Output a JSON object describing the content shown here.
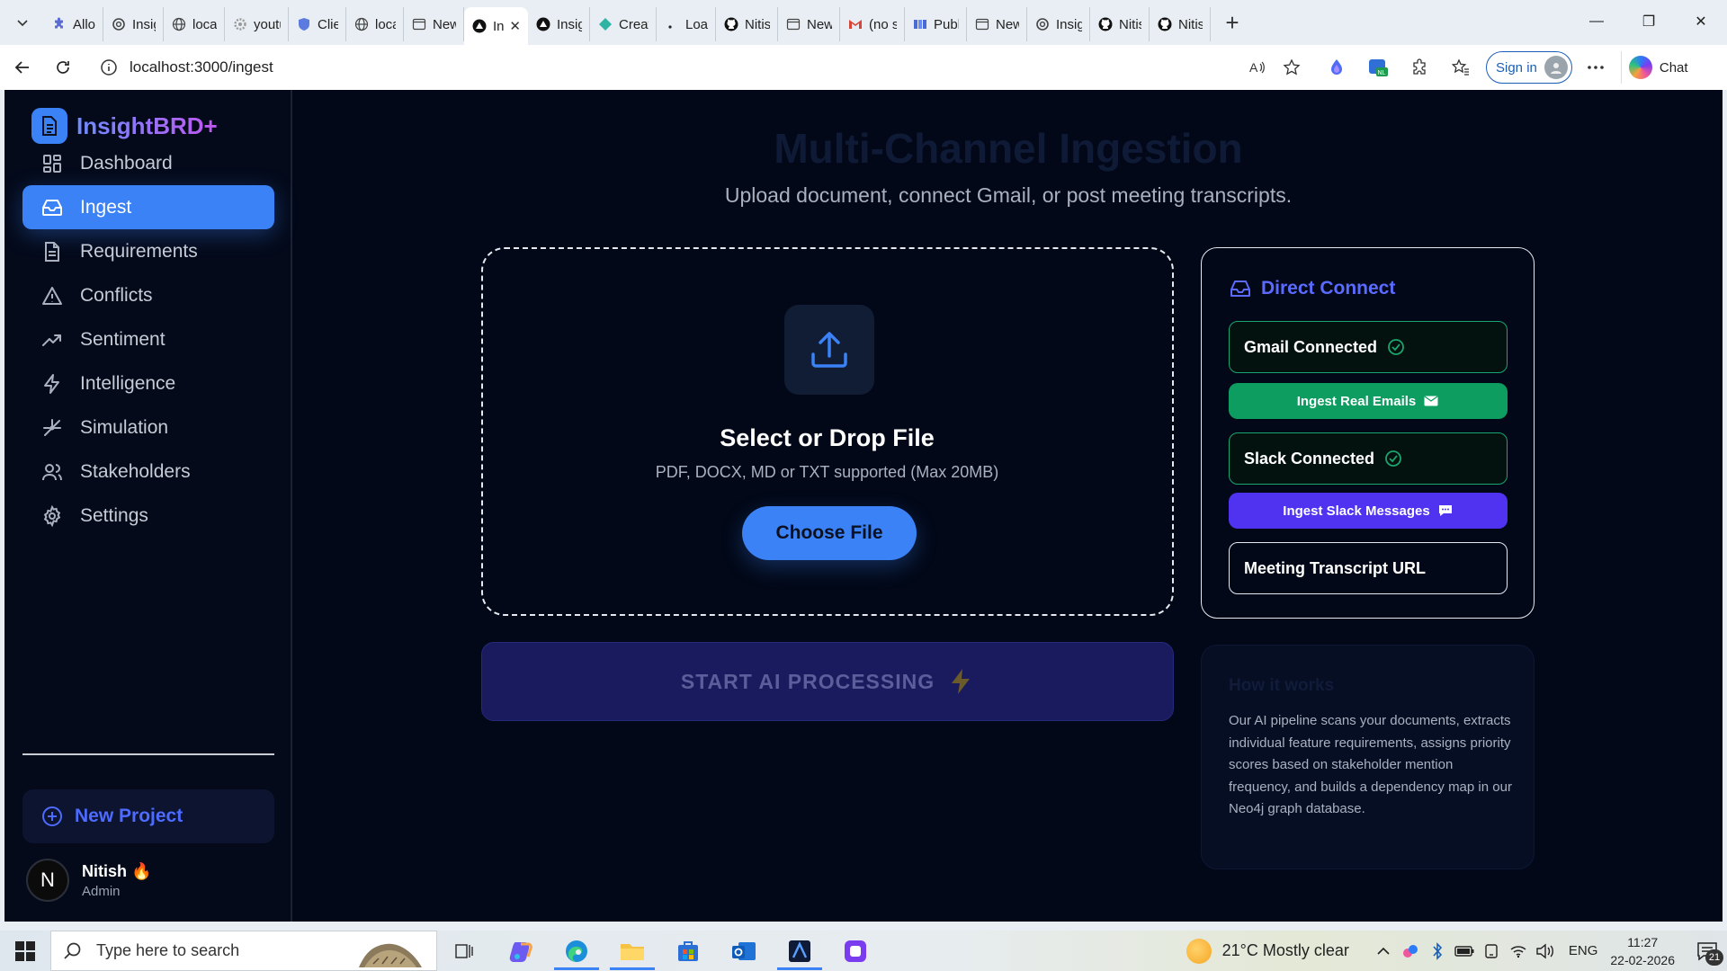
{
  "browser": {
    "tabs": [
      {
        "title": "Allow",
        "icon": "puzzle-icon"
      },
      {
        "title": "Insight",
        "icon": "openai-icon"
      },
      {
        "title": "localhc",
        "icon": "globe-icon"
      },
      {
        "title": "youtub",
        "icon": "settings-gear-icon"
      },
      {
        "title": "Client",
        "icon": "shield-icon"
      },
      {
        "title": "localhc",
        "icon": "globe-icon"
      },
      {
        "title": "New ta",
        "icon": "newtab-icon"
      },
      {
        "title": "In",
        "icon": "vercel-icon",
        "active": true
      },
      {
        "title": "Insight",
        "icon": "vercel-icon"
      },
      {
        "title": "Create",
        "icon": "diamond-icon"
      },
      {
        "title": "Loadir",
        "icon": "dot-icon"
      },
      {
        "title": "Nitish",
        "icon": "github-icon"
      },
      {
        "title": "New ta",
        "icon": "newtab-icon"
      },
      {
        "title": "(no su",
        "icon": "gmail-icon"
      },
      {
        "title": "Publis",
        "icon": "grid-icon"
      },
      {
        "title": "New ta",
        "icon": "newtab-icon"
      },
      {
        "title": "Insight",
        "icon": "openai-icon"
      },
      {
        "title": "Nitish",
        "icon": "github-icon"
      },
      {
        "title": "Nitish",
        "icon": "github-icon"
      }
    ],
    "url": "localhost:3000/ingest",
    "sign_in_label": "Sign in",
    "chat_label": "Chat"
  },
  "sidebar": {
    "brand": "InsightBRD+",
    "items": [
      {
        "label": "Dashboard",
        "icon": "dashboard-grid-icon",
        "active": false
      },
      {
        "label": "Ingest",
        "icon": "inbox-icon",
        "active": true
      },
      {
        "label": "Requirements",
        "icon": "file-text-icon",
        "active": false
      },
      {
        "label": "Conflicts",
        "icon": "alert-triangle-icon",
        "active": false
      },
      {
        "label": "Sentiment",
        "icon": "trending-up-icon",
        "active": false
      },
      {
        "label": "Intelligence",
        "icon": "zap-icon",
        "active": false
      },
      {
        "label": "Simulation",
        "icon": "simulation-icon",
        "active": false
      },
      {
        "label": "Stakeholders",
        "icon": "users-icon",
        "active": false
      },
      {
        "label": "Settings",
        "icon": "gear-icon",
        "active": false
      }
    ],
    "new_project_label": "New Project",
    "user": {
      "initial": "N",
      "name": "Nitish 🔥",
      "role": "Admin"
    }
  },
  "main": {
    "title": "Multi-Channel Ingestion",
    "subtitle": "Upload document, connect Gmail, or post meeting transcripts.",
    "dropzone": {
      "title": "Select or Drop File",
      "hint": "PDF, DOCX, MD or TXT supported (Max 20MB)",
      "button_label": "Choose File"
    },
    "start_label": "START AI PROCESSING",
    "direct_connect": {
      "title": "Direct Connect",
      "gmail_status": "Gmail Connected",
      "gmail_action": "Ingest Real Emails",
      "slack_status": "Slack Connected",
      "slack_action": "Ingest Slack Messages",
      "transcript_label": "Meeting Transcript URL"
    },
    "how": {
      "title": "How it works",
      "body": "Our AI pipeline scans your documents, extracts individual feature requirements, assigns priority scores based on stakeholder mention frequency, and builds a dependency map in our Neo4j graph database."
    }
  },
  "taskbar": {
    "search_placeholder": "Type here to search",
    "weather": "21°C  Mostly clear",
    "lang": "ENG",
    "time": "11:27",
    "date": "22-02-2026",
    "notifications": "21"
  },
  "colors": {
    "accent": "#3b82f6",
    "app_bg": "#020817",
    "connected_green": "#0e9d61",
    "slack_purple": "#4f33f0",
    "brand_gradient_start": "#6d8cff",
    "brand_gradient_end": "#c157f0"
  }
}
